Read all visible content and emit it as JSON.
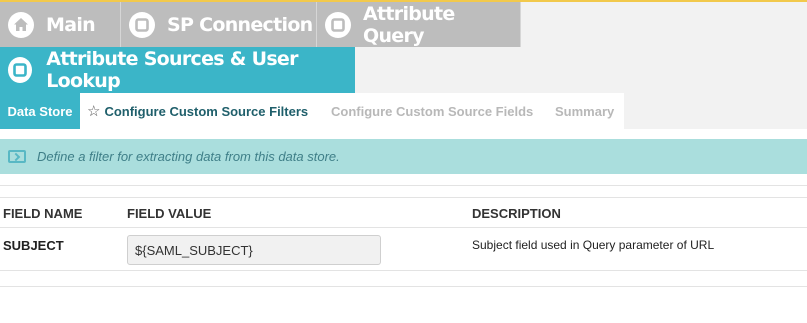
{
  "nav": {
    "main_label": "Main",
    "sp_connection_label": "SP Connection",
    "attribute_query_label": "Attribute Query",
    "current_label": "Attribute Sources & User Lookup",
    "main_icon": "home-icon",
    "step_icon": "stop-circle-icon"
  },
  "steps": {
    "data_store": "Data Store",
    "configure_filters": "Configure Custom Source Filters",
    "configure_fields": "Configure Custom Source Fields",
    "summary": "Summary"
  },
  "info": {
    "text": "Define a filter for extracting data from this data store."
  },
  "table": {
    "headers": [
      "FIELD NAME",
      "FIELD VALUE",
      "DESCRIPTION"
    ],
    "rows": [
      {
        "name": "SUBJECT",
        "value": "${SAML_SUBJECT}",
        "description": "Subject field used in Query parameter of URL"
      }
    ]
  },
  "colors": {
    "accent": "#3bb5c8",
    "nav_inactive": "#bdbdbd",
    "info_bg": "#aadedd",
    "top_border": "#f2c94c"
  }
}
